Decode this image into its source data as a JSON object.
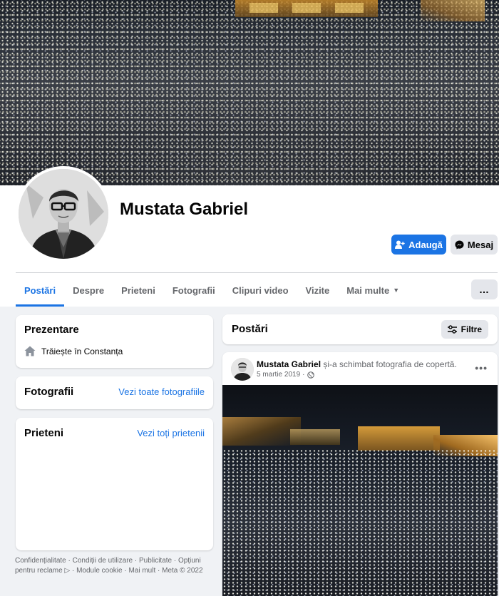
{
  "profile": {
    "name": "Mustata Gabriel",
    "add_label": "Adaugă",
    "message_label": "Mesaj"
  },
  "tabs": [
    {
      "label": "Postări",
      "active": true
    },
    {
      "label": "Despre"
    },
    {
      "label": "Prieteni"
    },
    {
      "label": "Fotografii"
    },
    {
      "label": "Clipuri video"
    },
    {
      "label": "Vizite"
    },
    {
      "label": "Mai multe"
    }
  ],
  "more_menu_icon": "…",
  "intro": {
    "title": "Prezentare",
    "lives_in": "Trăiește în Constanța",
    "icon": "home-icon"
  },
  "photos": {
    "title": "Fotografii",
    "link": "Vezi toate fotografiile"
  },
  "friends": {
    "title": "Prieteni",
    "link": "Vezi toți prietenii"
  },
  "footer": {
    "line1": "Confidențialitate · Condiții de utilizare · Publicitate · Opțiuni",
    "line2a": "pentru reclame",
    "line2b": "· Module cookie · Mai mult · Meta © 2022"
  },
  "posts": {
    "title": "Postări",
    "filter_label": "Filtre",
    "items": [
      {
        "author": "Mustata Gabriel",
        "action": "și-a schimbat fotografia de copertă.",
        "date": "5 martie 2019",
        "privacy_icon": "globe-icon"
      }
    ]
  },
  "colors": {
    "accent": "#1b74e4",
    "page_bg": "#f0f2f5",
    "secondary_text": "#65676b"
  }
}
